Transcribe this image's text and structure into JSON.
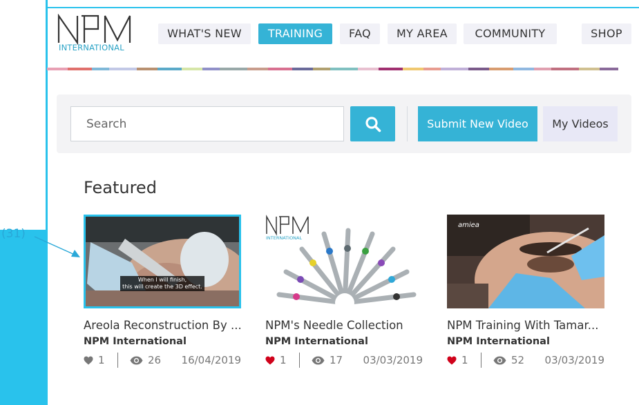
{
  "annotation": {
    "label": "(31)"
  },
  "logo": {
    "sub": "INTERNATIONAL"
  },
  "nav": [
    {
      "label": "WHAT'S NEW"
    },
    {
      "label": "TRAINING"
    },
    {
      "label": "FAQ"
    },
    {
      "label": "MY AREA"
    },
    {
      "label": "COMMUNITY"
    },
    {
      "label": "SHOP"
    }
  ],
  "search": {
    "placeholder": "Search",
    "submit_label": "Submit New Video",
    "my_videos_label": "My Videos"
  },
  "featured": {
    "heading": "Featured",
    "videos": [
      {
        "title": "Areola Reconstruction By ...",
        "author": "NPM International",
        "likes": "1",
        "views": "26",
        "date": "16/04/2019",
        "caption_line1": "When I will finish,",
        "caption_line2": "this will create the 3D effect.",
        "liked": false
      },
      {
        "title": "NPM's Needle Collection",
        "author": "NPM International",
        "likes": "1",
        "views": "17",
        "date": "03/03/2019",
        "liked": true,
        "thumb_logo_sub": "INTERNATIONAL"
      },
      {
        "title": "NPM Training With Tamar...",
        "author": "NPM International",
        "likes": "1",
        "views": "52",
        "date": "03/03/2019",
        "liked": true,
        "brand": "amiea"
      }
    ]
  },
  "colors": {
    "accent": "#35b3d6",
    "annotation": "#29c2ec",
    "heart_liked": "#d0021b",
    "heart_default": "#777777"
  }
}
